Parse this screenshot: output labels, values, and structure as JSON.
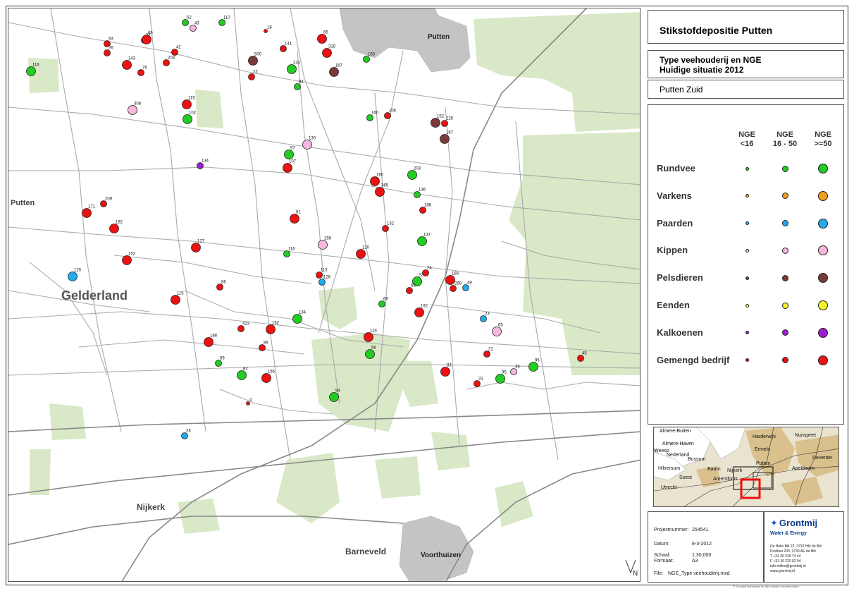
{
  "title": "Stikstofdepositie Putten",
  "subtitle": [
    "Type veehouderij en NGE",
    "Huidige situatie 2012"
  ],
  "area": "Putten Zuid",
  "legend": {
    "headers": [
      "NGE\n<16",
      "NGE\n16 - 50",
      "NGE\n>=50"
    ],
    "categories": [
      {
        "label": "Rundvee",
        "color": "#22cc22"
      },
      {
        "label": "Varkens",
        "color": "#f0a020"
      },
      {
        "label": "Paarden",
        "color": "#22aaee"
      },
      {
        "label": "Kippen",
        "color": "#f6b6dd"
      },
      {
        "label": "Pelsdieren",
        "color": "#7a3a3a"
      },
      {
        "label": "Eenden",
        "color": "#f5f52a"
      },
      {
        "label": "Kalkoenen",
        "color": "#9a1ecf"
      },
      {
        "label": "Gemengd bedrijf",
        "color": "#ee1111"
      }
    ]
  },
  "map_labels": {
    "gelderland": "Gelderland",
    "putten_west": "Putten",
    "putten_north": "Putten",
    "nijkerk": "Nijkerk",
    "barneveld": "Barneveld",
    "voorthuizen": "Voorthuizen",
    "north": "N"
  },
  "inset_labels": [
    "Almere-Buiten",
    "Almere-Haven",
    "Harderwijk",
    "Nunspeet",
    "Nederland",
    "Bussum",
    "Ermelo",
    "Hilversum",
    "Baarn",
    "Nijkerk",
    "Putten",
    "Apeldoorn",
    "Deventer",
    "Soest",
    "Amersfoort",
    "Utrecht",
    "Weesp"
  ],
  "info": {
    "project_label": "Projectnummer:",
    "project_value": "254541",
    "date_label": "Datum:",
    "date_value": "8-3-2012",
    "scale_label": "Schaal:",
    "scale_value": "1:30,000",
    "format_label": "Formaat:",
    "format_value": "A3",
    "file_label": "File:",
    "file_value": "NGE_Type veehouderij.mxd"
  },
  "company": {
    "name": "Grontmij",
    "division": "Water & Energy",
    "lines": [
      "De Holle Bilt 22, 3732 HM de Bilt",
      "Postbus 203, 3730 AE de Bilt",
      "T +31 30 220 74 44",
      "F +31 30 220 02 94",
      "info.milieu@grontmij.nl",
      "www.grontmij.nl"
    ]
  },
  "copyright": "© Grontmij Nederland bv. Alle rechten voorbehouden",
  "markers": [
    {
      "l": "93",
      "c": 7,
      "s": 1
    },
    {
      "l": "26",
      "c": 7,
      "s": 1
    },
    {
      "l": "143",
      "c": 7,
      "s": 2
    },
    {
      "l": "76",
      "c": 7,
      "s": 1
    },
    {
      "l": "27",
      "c": 7,
      "s": 1
    },
    {
      "l": "69",
      "c": 7,
      "s": 2
    },
    {
      "l": "42",
      "c": 7,
      "s": 1
    },
    {
      "l": "203",
      "c": 7,
      "s": 1
    },
    {
      "l": "52",
      "c": 0,
      "s": 1
    },
    {
      "l": "43",
      "c": 3,
      "s": 1
    },
    {
      "l": "110",
      "c": 0,
      "s": 1
    },
    {
      "l": "18",
      "c": 7,
      "s": 0
    },
    {
      "l": "141",
      "c": 7,
      "s": 1
    },
    {
      "l": "65",
      "c": 7,
      "s": 2
    },
    {
      "l": "319",
      "c": 7,
      "s": 2
    },
    {
      "l": "500",
      "c": 4,
      "s": 2
    },
    {
      "l": "231",
      "c": 0,
      "s": 2
    },
    {
      "l": "22",
      "c": 7,
      "s": 1
    },
    {
      "l": "167",
      "c": 4,
      "s": 2
    },
    {
      "l": "183",
      "c": 0,
      "s": 1
    },
    {
      "l": "116",
      "c": 0,
      "s": 2
    },
    {
      "l": "115",
      "c": 7,
      "s": 2
    },
    {
      "l": "308",
      "c": 3,
      "s": 2
    },
    {
      "l": "102",
      "c": 0,
      "s": 2
    },
    {
      "l": "84",
      "c": 0,
      "s": 1
    },
    {
      "l": "160",
      "c": 0,
      "s": 1
    },
    {
      "l": "106",
      "c": 7,
      "s": 1
    },
    {
      "l": "225",
      "c": 7,
      "s": 1
    },
    {
      "l": "152",
      "c": 4,
      "s": 2
    },
    {
      "l": "167",
      "c": 4,
      "s": 2
    },
    {
      "l": "134",
      "c": 6,
      "s": 1
    },
    {
      "l": "97",
      "c": 0,
      "s": 2
    },
    {
      "l": "107",
      "c": 7,
      "s": 2
    },
    {
      "l": "130",
      "c": 3,
      "s": 2
    },
    {
      "l": "160",
      "c": 7,
      "s": 2
    },
    {
      "l": "209",
      "c": 7,
      "s": 1
    },
    {
      "l": "171",
      "c": 7,
      "s": 2
    },
    {
      "l": "182",
      "c": 7,
      "s": 2
    },
    {
      "l": "365",
      "c": 7,
      "s": 2
    },
    {
      "l": "203",
      "c": 0,
      "s": 2
    },
    {
      "l": "136",
      "c": 0,
      "s": 1
    },
    {
      "l": "186",
      "c": 7,
      "s": 1
    },
    {
      "l": "91",
      "c": 7,
      "s": 2
    },
    {
      "l": "132",
      "c": 7,
      "s": 1
    },
    {
      "l": "137",
      "c": 0,
      "s": 2
    },
    {
      "l": "127",
      "c": 7,
      "s": 2
    },
    {
      "l": "116",
      "c": 0,
      "s": 1
    },
    {
      "l": "159",
      "c": 3,
      "s": 2
    },
    {
      "l": "120",
      "c": 7,
      "s": 2
    },
    {
      "l": "152",
      "c": 7,
      "s": 2
    },
    {
      "l": "120",
      "c": 2,
      "s": 2
    },
    {
      "l": "115",
      "c": 7,
      "s": 2
    },
    {
      "l": "86",
      "c": 7,
      "s": 1
    },
    {
      "l": "113",
      "c": 7,
      "s": 1
    },
    {
      "l": "128",
      "c": 2,
      "s": 1
    },
    {
      "l": "227",
      "c": 0,
      "s": 2
    },
    {
      "l": "193",
      "c": 7,
      "s": 2
    },
    {
      "l": "299",
      "c": 7,
      "s": 1
    },
    {
      "l": "49",
      "c": 2,
      "s": 1
    },
    {
      "l": "134",
      "c": 0,
      "s": 2
    },
    {
      "l": "68",
      "c": 0,
      "s": 1
    },
    {
      "l": "192",
      "c": 7,
      "s": 2
    },
    {
      "l": "423",
      "c": 7,
      "s": 1
    },
    {
      "l": "152",
      "c": 7,
      "s": 2
    },
    {
      "l": "188",
      "c": 7,
      "s": 2
    },
    {
      "l": "124",
      "c": 7,
      "s": 2
    },
    {
      "l": "68",
      "c": 0,
      "s": 2
    },
    {
      "l": "69",
      "c": 0,
      "s": 1
    },
    {
      "l": "89",
      "c": 7,
      "s": 1
    },
    {
      "l": "165",
      "c": 7,
      "s": 2
    },
    {
      "l": "82",
      "c": 0,
      "s": 2
    },
    {
      "l": "83",
      "c": 7,
      "s": 2
    },
    {
      "l": "31",
      "c": 7,
      "s": 1
    },
    {
      "l": "95",
      "c": 0,
      "s": 2
    },
    {
      "l": "96",
      "c": 0,
      "s": 2
    },
    {
      "l": "45",
      "c": 7,
      "s": 1
    },
    {
      "l": "94",
      "c": 0,
      "s": 2
    },
    {
      "l": "28",
      "c": 2,
      "s": 1
    },
    {
      "l": "23",
      "c": 2,
      "s": 1
    },
    {
      "l": "65",
      "c": 3,
      "s": 2
    },
    {
      "l": "36",
      "c": 3,
      "s": 1
    },
    {
      "l": "21",
      "c": 7,
      "s": 1
    },
    {
      "l": "4",
      "c": 7,
      "s": 0
    },
    {
      "l": "24",
      "c": 7,
      "s": 1
    },
    {
      "l": "63",
      "c": 7,
      "s": 1
    }
  ]
}
